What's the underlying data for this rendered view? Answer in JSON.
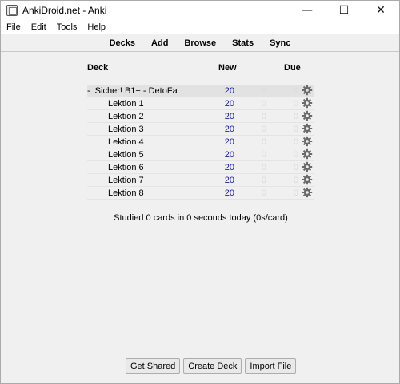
{
  "window": {
    "title": "AnkiDroid.net - Anki"
  },
  "window_controls": {
    "minimize": "—",
    "maximize": "☐",
    "close": "✕"
  },
  "menu": [
    "File",
    "Edit",
    "Tools",
    "Help"
  ],
  "toolbar": [
    "Decks",
    "Add",
    "Browse",
    "Stats",
    "Sync"
  ],
  "table": {
    "headers": {
      "deck": "Deck",
      "new": "New",
      "due": "Due"
    },
    "parent": {
      "toggle": "-",
      "name": "Sicher! B1+ - DetoFa",
      "new": "20",
      "learn": "0",
      "due": "0"
    },
    "children": [
      {
        "name": "Lektion 1",
        "new": "20",
        "learn": "0",
        "due": "0"
      },
      {
        "name": "Lektion 2",
        "new": "20",
        "learn": "0",
        "due": "0"
      },
      {
        "name": "Lektion 3",
        "new": "20",
        "learn": "0",
        "due": "0"
      },
      {
        "name": "Lektion 4",
        "new": "20",
        "learn": "0",
        "due": "0"
      },
      {
        "name": "Lektion 5",
        "new": "20",
        "learn": "0",
        "due": "0"
      },
      {
        "name": "Lektion 6",
        "new": "20",
        "learn": "0",
        "due": "0"
      },
      {
        "name": "Lektion 7",
        "new": "20",
        "learn": "0",
        "due": "0"
      },
      {
        "name": "Lektion 8",
        "new": "20",
        "learn": "0",
        "due": "0"
      }
    ]
  },
  "studied_text": "Studied 0 cards in 0 seconds today (0s/card)",
  "buttons": {
    "get_shared": "Get Shared",
    "create_deck": "Create Deck",
    "import_file": "Import File"
  },
  "colors": {
    "new_count": "#1a1aa6",
    "zero_count": "#dadada",
    "parent_row_bg": "#e2e2e2"
  }
}
